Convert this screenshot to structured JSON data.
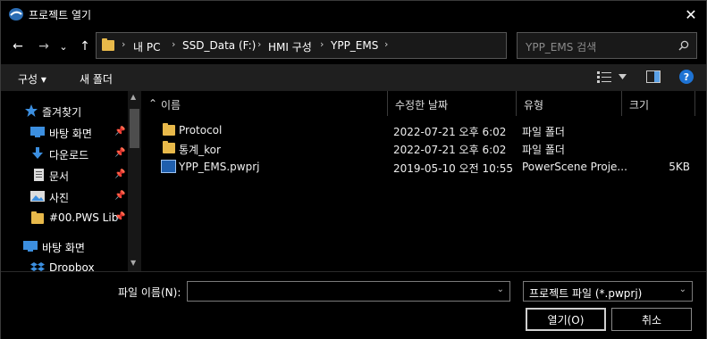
{
  "window": {
    "title": "프로젝트 열기",
    "close_glyph": "✕"
  },
  "nav": {
    "back_icon": "←",
    "forward_icon": "→",
    "recent_icon": "⌄",
    "up_icon": "↑",
    "breadcrumb": [
      "내 PC",
      "SSD_Data (F:)",
      "HMI 구성",
      "YPP_EMS"
    ],
    "separator": "›",
    "dropdown_icon": "⌄",
    "refresh_icon": "↻",
    "search_placeholder": "YPP_EMS 검색"
  },
  "toolbar": {
    "organize_label": "구성 ▾",
    "new_folder_label": "새 폴더"
  },
  "sidebar": {
    "items": [
      {
        "label": "즐겨찾기",
        "icon": "star-icon",
        "pinned": false
      },
      {
        "label": "바탕 화면",
        "icon": "desktop-icon",
        "pinned": true
      },
      {
        "label": "다운로드",
        "icon": "download-icon",
        "pinned": true
      },
      {
        "label": "문서",
        "icon": "document-icon",
        "pinned": true
      },
      {
        "label": "사진",
        "icon": "picture-icon",
        "pinned": true
      },
      {
        "label": "#00.PWS Lib",
        "icon": "folder-icon",
        "pinned": true
      },
      {
        "label": "바탕 화면",
        "icon": "desktop-icon",
        "pinned": false
      },
      {
        "label": "Dropbox",
        "icon": "dropbox-icon",
        "pinned": false
      }
    ],
    "pin_glyph": "📌"
  },
  "files": {
    "columns": [
      "이름",
      "수정한 날짜",
      "유형",
      "크기"
    ],
    "rows": [
      {
        "name": "Protocol",
        "date": "2022-07-21 오후 6:02",
        "type": "파일 폴더",
        "size": "",
        "kind": "folder"
      },
      {
        "name": "통계_kor",
        "date": "2022-07-21 오후 6:02",
        "type": "파일 폴더",
        "size": "",
        "kind": "folder"
      },
      {
        "name": "YPP_EMS.pwprj",
        "date": "2019-05-10 오전 10:55",
        "type": "PowerScene Proje...",
        "size": "5KB",
        "kind": "file"
      }
    ]
  },
  "footer": {
    "filename_label": "파일 이름(N):",
    "filename_value": "",
    "filetype_value": "프로젝트 파일 (*.pwprj)",
    "open_label": "열기(O)",
    "cancel_label": "취소"
  },
  "colors": {
    "background": "#000000",
    "folder": "#e8b94a",
    "accent_blue": "#2b88d8"
  }
}
